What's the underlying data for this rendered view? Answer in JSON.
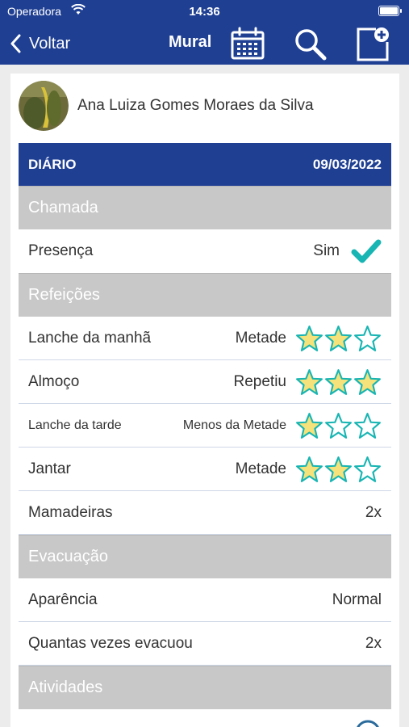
{
  "status": {
    "carrier": "Operadora",
    "time": "14:36"
  },
  "nav": {
    "back": "Voltar",
    "title": "Mural"
  },
  "profile": {
    "name": "Ana Luiza Gomes Moraes da Silva"
  },
  "diary": {
    "label": "DIÁRIO",
    "date": "09/03/2022"
  },
  "sections": {
    "chamada": "Chamada",
    "refeicoes": "Refeições",
    "evacuacao": "Evacuação",
    "atividades": "Atividades"
  },
  "presenca": {
    "label": "Presença",
    "value": "Sim"
  },
  "meals": [
    {
      "label": "Lanche da manhã",
      "value": "Metade",
      "stars": 2
    },
    {
      "label": "Almoço",
      "value": "Repetiu",
      "stars": 3
    },
    {
      "label": "Lanche da tarde",
      "value": "Menos da Metade",
      "stars": 1
    },
    {
      "label": "Jantar",
      "value": "Metade",
      "stars": 2
    }
  ],
  "mamadeiras": {
    "label": "Mamadeiras",
    "value": "2x"
  },
  "aparencia": {
    "label": "Aparência",
    "value": "Normal"
  },
  "evacuou": {
    "label": "Quantas vezes evacuou",
    "value": "2x"
  },
  "colors": {
    "brand": "#1f3f93",
    "section": "#c8c8c8",
    "starFill": "#f6e27a",
    "starStroke": "#17b5b3",
    "check": "#17b5b3"
  }
}
